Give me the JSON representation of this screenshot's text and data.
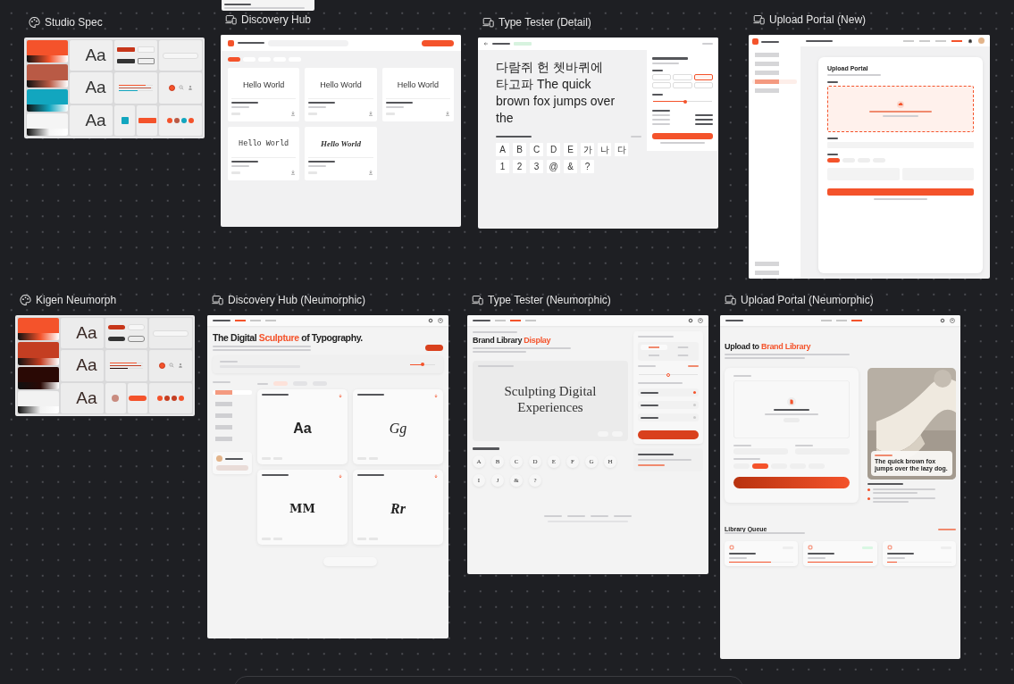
{
  "canvas": {
    "frames": [
      {
        "kind": "palette",
        "title": "Studio Spec",
        "swatches": [
          {
            "color": "#f4532b"
          },
          {
            "color": "#b95a45"
          },
          {
            "color": "#12a6bf"
          },
          {
            "color": "#f5f5f5"
          }
        ],
        "specimens": [
          "Aa",
          "Aa",
          "Aa"
        ],
        "bars": [
          {
            "level": 0.8
          },
          {
            "level": 0.95
          },
          {
            "level": 0.55
          }
        ]
      },
      {
        "kind": "discovery",
        "title": "Discovery Hub",
        "chips": [
          {
            "selected": true
          },
          {
            "selected": false
          },
          {
            "selected": false
          },
          {
            "selected": false
          },
          {
            "selected": false
          }
        ],
        "fonts": [
          {
            "sample": "Hello World",
            "kind": "sans"
          },
          {
            "sample": "Hello World",
            "kind": "sans"
          },
          {
            "sample": "Hello World",
            "kind": "sans"
          },
          {
            "sample": "Hello World",
            "kind": "mono"
          },
          {
            "sample": "Hello World",
            "kind": "serif"
          }
        ]
      },
      {
        "kind": "tester",
        "title": "Type Tester (Detail)",
        "preview": "다람쥐 헌 쳇바퀴에 타고파 The quick brown fox jumps over the",
        "glyphs": [
          "A",
          "B",
          "C",
          "D",
          "E",
          "가",
          "나",
          "다",
          "1",
          "2",
          "3",
          "@",
          "&",
          "?"
        ],
        "weights": [
          {
            "selected": false
          },
          {
            "selected": false
          },
          {
            "selected": true
          },
          {
            "selected": false
          },
          {
            "selected": false
          },
          {
            "selected": false
          }
        ],
        "size": {
          "level": 0.55
        }
      },
      {
        "kind": "upload",
        "title": "Upload Portal (New)",
        "nav_side": [
          {
            "selected": false
          },
          {
            "selected": false
          },
          {
            "selected": false
          },
          {
            "selected": true
          },
          {
            "selected": false
          }
        ],
        "nav_top": [
          {
            "selected": false
          },
          {
            "selected": false
          },
          {
            "selected": false
          },
          {
            "selected": true
          }
        ],
        "card_title": "Upload Portal",
        "tags": [
          {
            "selected": true
          },
          {
            "selected": false
          },
          {
            "selected": false
          },
          {
            "selected": false
          }
        ]
      },
      {
        "kind": "neu_palette",
        "title": "Kigen Neumorph",
        "swatches": [
          {
            "color": "#f4532b"
          },
          {
            "color": "#c43e22"
          },
          {
            "color": "#2a0905"
          },
          {
            "color": "#f2f2f2"
          }
        ],
        "specimens": [
          "Aa",
          "Aa",
          "Aa"
        ],
        "bars": [
          {
            "level": 0.8
          },
          {
            "level": 0.95
          },
          {
            "level": 0.55
          }
        ]
      },
      {
        "kind": "neu_discovery",
        "title": "Discovery Hub (Neumorphic)",
        "tabs": [
          {
            "selected": true
          },
          {
            "selected": false
          },
          {
            "selected": false
          }
        ],
        "hero": {
          "lead": "The Digital ",
          "accent": "Sculpture",
          "tail": " of Typography."
        },
        "preview_size": {
          "level": 0.5
        },
        "categories": [
          {
            "selected": true
          },
          {
            "selected": false
          },
          {
            "selected": false
          },
          {
            "selected": false
          },
          {
            "selected": false
          }
        ],
        "sorts": [
          {
            "selected": true
          },
          {
            "selected": false
          },
          {
            "selected": false
          }
        ],
        "fonts": [
          {
            "glyph": "Aa",
            "kind": "sans"
          },
          {
            "glyph": "Gg",
            "kind": "italic"
          },
          {
            "glyph": "MM",
            "kind": "slab"
          },
          {
            "glyph": "Rr",
            "kind": "serif"
          }
        ]
      },
      {
        "kind": "neu_tester",
        "title": "Type Tester (Neumorphic)",
        "tabs": [
          {
            "selected": false
          },
          {
            "selected": true
          },
          {
            "selected": false
          }
        ],
        "heading": {
          "lead": "Brand Library ",
          "accent": "Display"
        },
        "sample": "Sculpting Digital Experiences",
        "glyphs": [
          "A",
          "B",
          "C",
          "D",
          "E",
          "F",
          "G",
          "H",
          "I",
          "J",
          "&",
          "?"
        ],
        "weights": [
          {
            "selected": true
          },
          {
            "selected": false
          },
          {
            "selected": false
          },
          {
            "selected": false
          }
        ],
        "size": {
          "level": 0.5
        },
        "features": [
          {
            "on": true
          },
          {
            "on": false
          },
          {
            "on": false
          }
        ]
      },
      {
        "kind": "neu_upload",
        "title": "Upload Portal (Neumorphic)",
        "tabs": [
          {
            "selected": false
          },
          {
            "selected": false
          },
          {
            "selected": true
          }
        ],
        "heading": {
          "lead": "Upload to ",
          "accent": "Brand Library"
        },
        "perms": [
          {
            "selected": false
          },
          {
            "selected": true
          },
          {
            "selected": false
          },
          {
            "selected": false
          },
          {
            "selected": false
          }
        ],
        "live_text": "The quick brown fox jumps over the lazy dog.",
        "queue_title": "Library Queue",
        "queue": [
          {
            "color": "#eeeeee",
            "level": 0.65
          },
          {
            "color": "#d9f7e3",
            "level": 1
          },
          {
            "color": "#eeeeee",
            "level": 0.15
          }
        ]
      }
    ]
  }
}
